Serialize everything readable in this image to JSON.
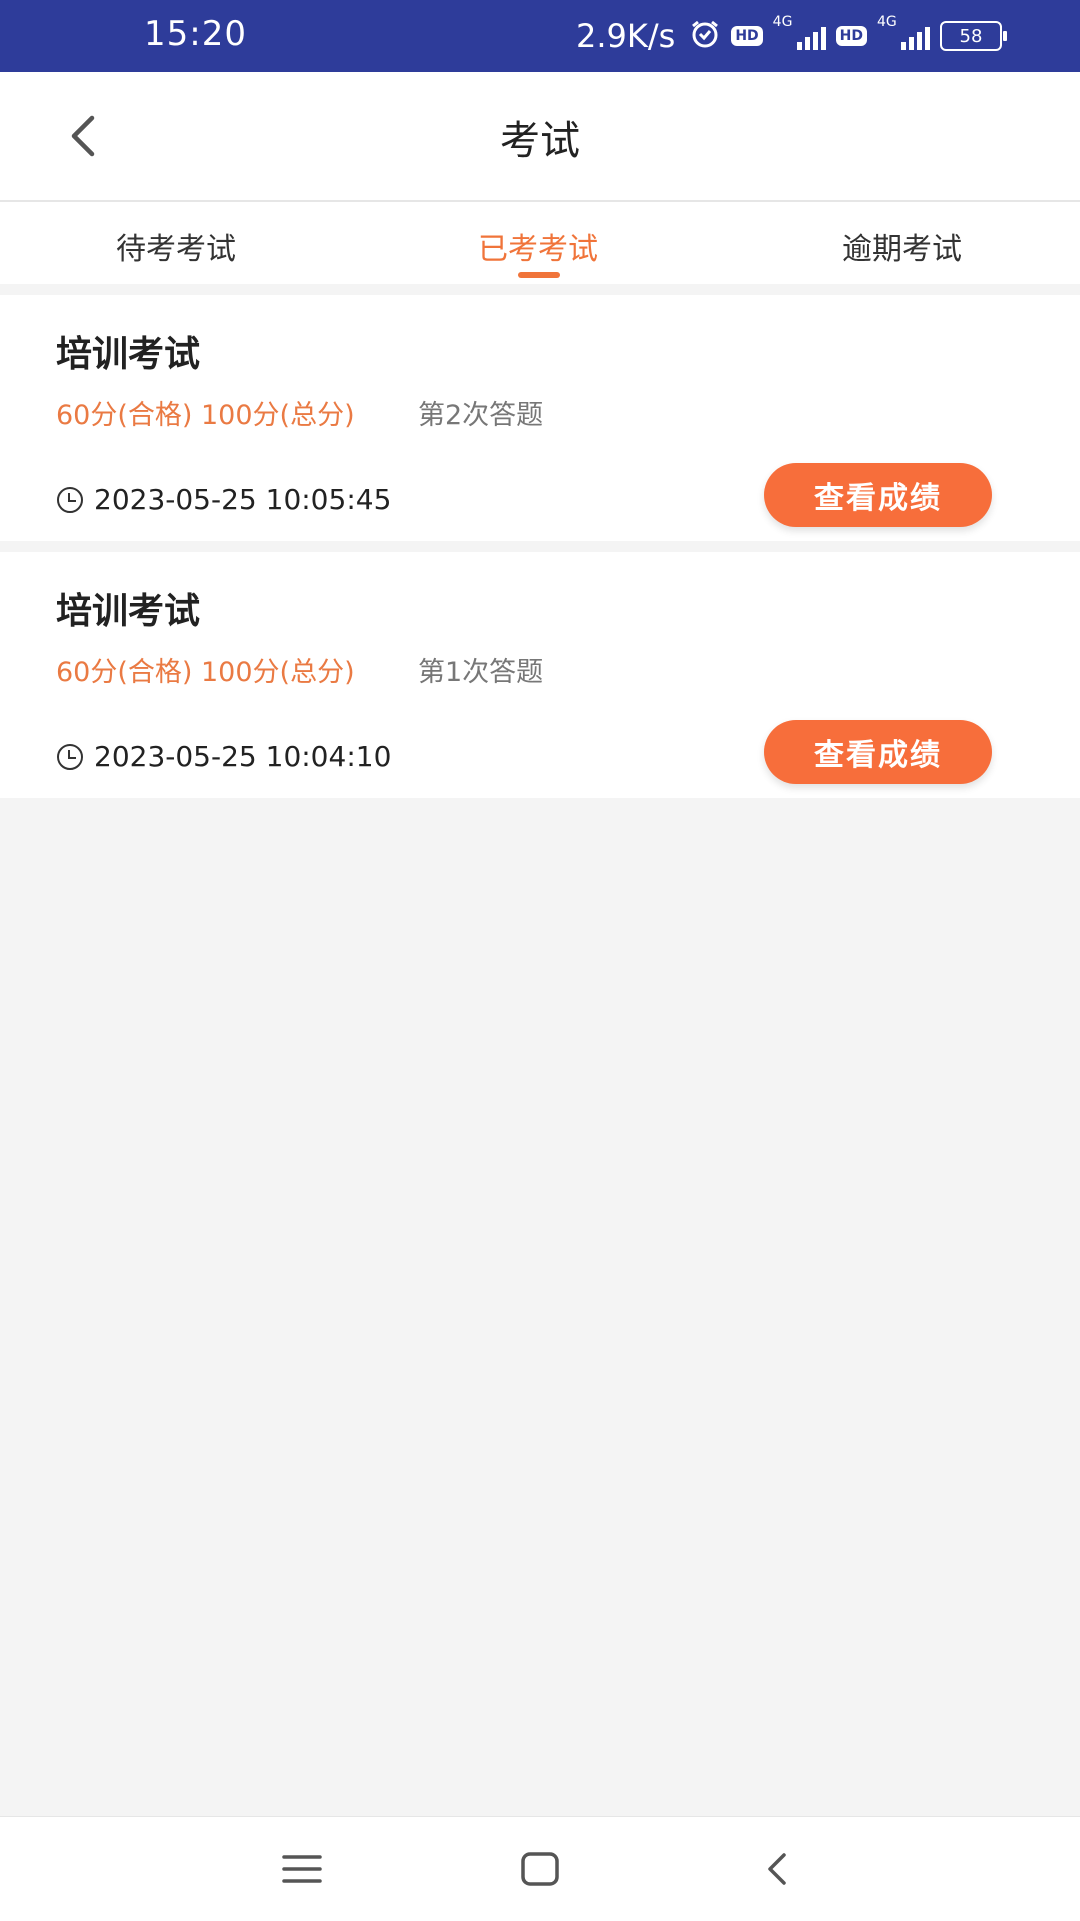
{
  "status_bar": {
    "time": "15:20",
    "net_speed": "2.9K/s",
    "sim1": {
      "hd": "HD",
      "net": "4G"
    },
    "sim2": {
      "hd": "HD",
      "net": "4G"
    },
    "battery": "58"
  },
  "header": {
    "title": "考试",
    "back_icon": "chevron-left-icon"
  },
  "tabs": [
    {
      "label": "待考考试",
      "active": false
    },
    {
      "label": "已考考试",
      "active": true
    },
    {
      "label": "逾期考试",
      "active": false
    }
  ],
  "exams": [
    {
      "title": "培训考试",
      "score": "60分(合格) 100分(总分)",
      "attempt": "第2次答题",
      "time": "2023-05-25 10:05:45",
      "button": "查看成绩"
    },
    {
      "title": "培训考试",
      "score": "60分(合格) 100分(总分)",
      "attempt": "第1次答题",
      "time": "2023-05-25 10:04:10",
      "button": "查看成绩"
    }
  ],
  "colors": {
    "status_bar": "#2e3c9a",
    "accent": "#f0743a",
    "button": "#f76e3b"
  },
  "bottom_nav": [
    "menu-icon",
    "home-square-icon",
    "back-chevron-icon"
  ]
}
